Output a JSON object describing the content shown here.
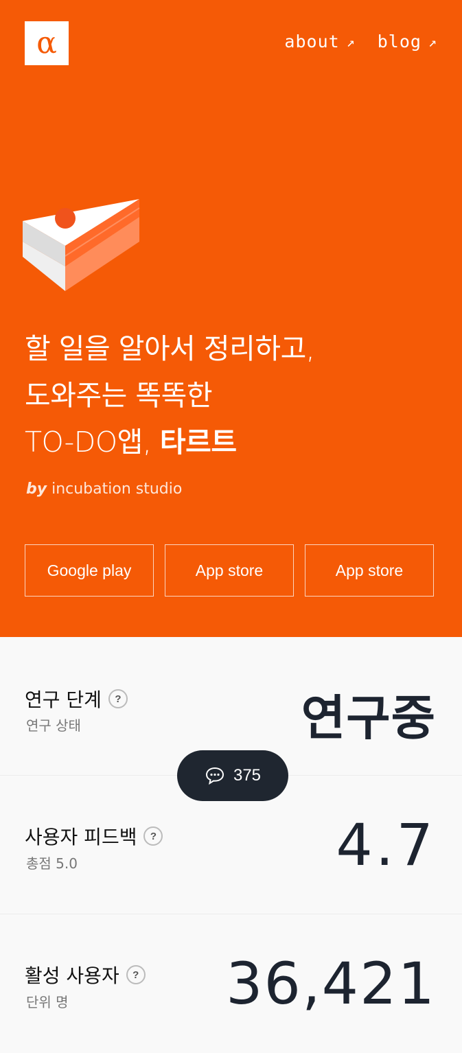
{
  "header": {
    "logo_glyph": "α",
    "nav": [
      {
        "label": "about",
        "arrow": "↗"
      },
      {
        "label": "blog",
        "arrow": "↗"
      }
    ]
  },
  "hero": {
    "headline_line1": "할 일을 알아서 정리하고,",
    "headline_line2": "도와주는 똑똑한",
    "headline_line3_prefix": "TO-DO앱, ",
    "headline_line3_bold": "타르트",
    "byline_by": "by",
    "byline_studio": " incubation studio",
    "stores": [
      "Google play",
      "App store",
      "App store"
    ]
  },
  "stats": [
    {
      "title": "연구 단계",
      "sub": "연구 상태",
      "value": "연구중"
    },
    {
      "title": "사용자 피드백",
      "sub": "총점 5.0",
      "value": "4.7"
    },
    {
      "title": "활성 사용자",
      "sub": "단위 명",
      "value": "36,421"
    }
  ],
  "help_glyph": "?",
  "comments": {
    "count": "375",
    "icon": "chat-bubble-icon"
  },
  "colors": {
    "brand": "#f55a06",
    "dark": "#1f2630",
    "value": "#1d2430"
  }
}
